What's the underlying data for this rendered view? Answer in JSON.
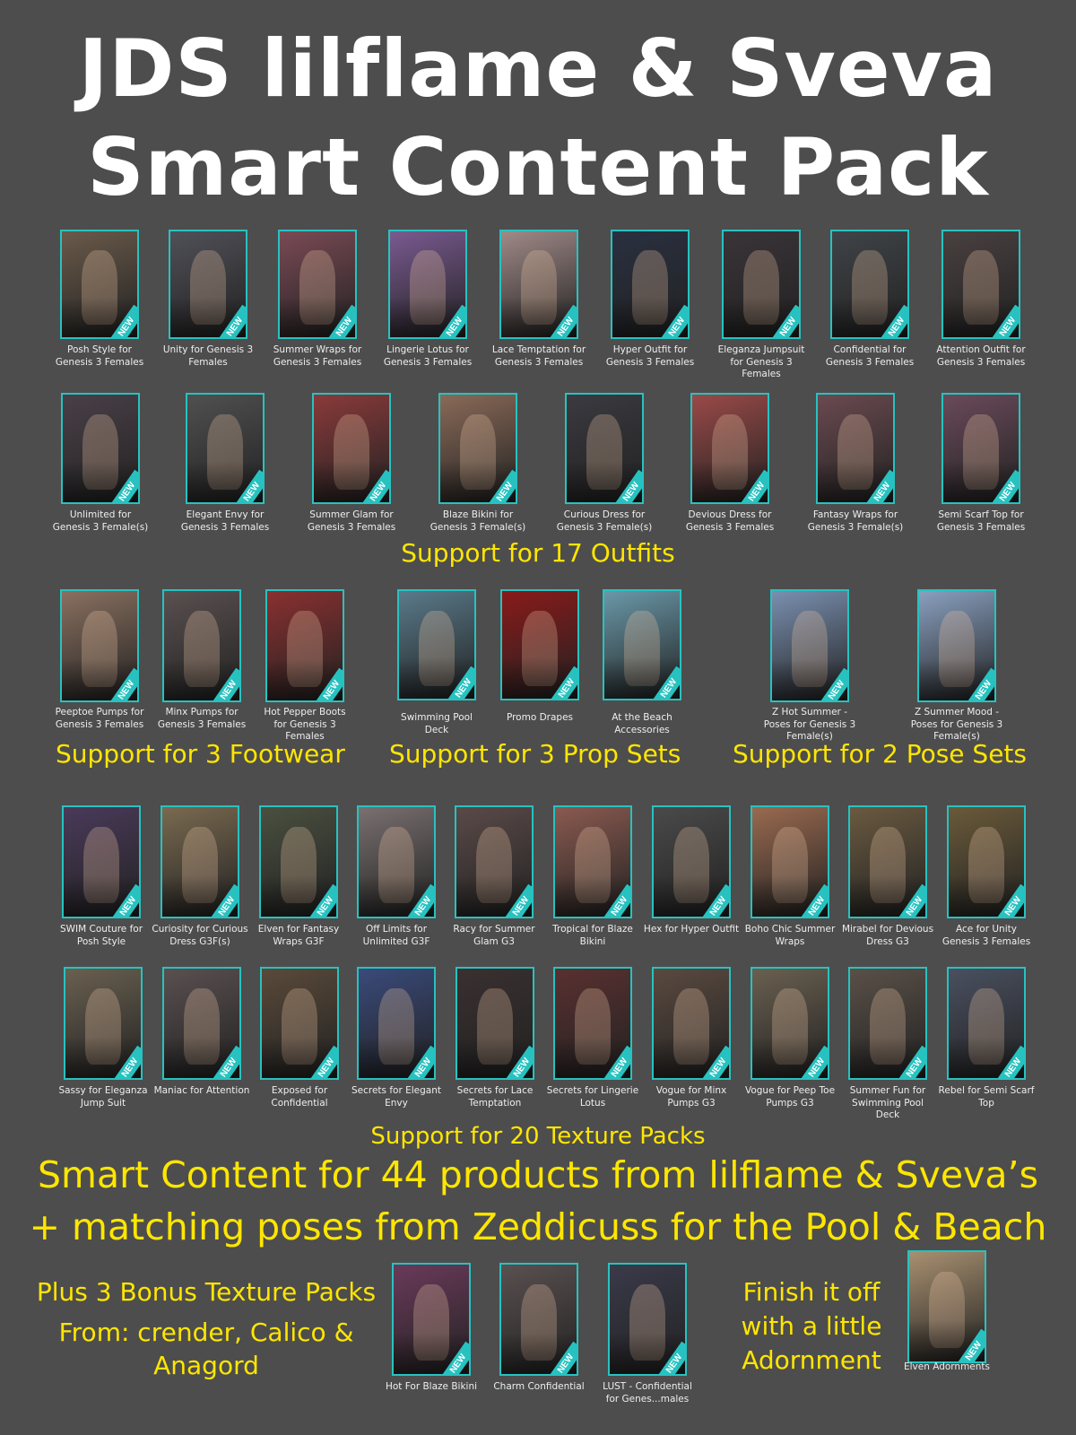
{
  "title_line1": "JDS lilflame & Sveva",
  "title_line2": "Smart Content Pack",
  "outfits_row1": [
    {
      "caption": "Posh Style for Genesis 3 Females",
      "color": "#6a5a4a"
    },
    {
      "caption": "Unity for Genesis 3 Females",
      "color": "#505058"
    },
    {
      "caption": "Summer Wraps for Genesis 3 Females",
      "color": "#7a4a55"
    },
    {
      "caption": "Lingerie Lotus for Genesis 3 Females",
      "color": "#7a5a90"
    },
    {
      "caption": "Lace Temptation for Genesis 3 Females",
      "color": "#a08a88"
    },
    {
      "caption": "Hyper Outfit for Genesis 3 Females",
      "color": "#2a3040"
    },
    {
      "caption": "Eleganza Jumpsuit for Genesis 3 Females",
      "color": "#3a3438"
    },
    {
      "caption": "Confidential for Genesis 3 Females",
      "color": "#404448"
    },
    {
      "caption": "Attention Outfit for Genesis 3 Females",
      "color": "#4a4040"
    }
  ],
  "outfits_row2": [
    {
      "caption": "Unlimited for Genesis 3 Female(s)",
      "color": "#4a4048"
    },
    {
      "caption": "Elegant Envy for Genesis 3 Females",
      "color": "#505050"
    },
    {
      "caption": "Summer Glam for Genesis 3 Females",
      "color": "#8a3a3a"
    },
    {
      "caption": "Blaze Bikini for Genesis 3 Female(s)",
      "color": "#8a6a58"
    },
    {
      "caption": "Curious Dress for Genesis 3 Female(s)",
      "color": "#3a3a40"
    },
    {
      "caption": "Devious Dress for Genesis 3 Females",
      "color": "#9a4a48"
    },
    {
      "caption": "Fantasy Wraps for Genesis 3 Female(s)",
      "color": "#6a4a50"
    },
    {
      "caption": "Semi Scarf Top for Genesis 3 Females",
      "color": "#6a4a5a"
    }
  ],
  "support_outfits": "Support for 17 Outfits",
  "footwear": [
    {
      "caption": "Peeptoe Pumps for Genesis 3 Females",
      "color": "#8a7060"
    },
    {
      "caption": "Minx Pumps for Genesis 3 Females",
      "color": "#5a5050"
    },
    {
      "caption": "Hot Pepper Boots for Genesis 3 Females",
      "color": "#8a3030"
    }
  ],
  "props": [
    {
      "caption": "Swimming Pool Deck",
      "color": "#5a7a8a"
    },
    {
      "caption": "Promo Drapes",
      "color": "#8a1a1a"
    },
    {
      "caption": "At the Beach Accessories",
      "color": "#6a98a8"
    }
  ],
  "poses": [
    {
      "caption": "Z Hot Summer - Poses for Genesis 3 Female(s)",
      "color": "#7a90b0"
    },
    {
      "caption": "Z Summer Mood - Poses for Genesis 3 Female(s)",
      "color": "#8aa0c0"
    }
  ],
  "support_footwear": "Support for 3 Footwear",
  "support_props": "Support for 3 Prop Sets",
  "support_poses": "Support for 2 Pose Sets",
  "textures_row1": [
    {
      "caption": "SWIM Couture for Posh Style",
      "color": "#4a3a5a"
    },
    {
      "caption": "Curiosity for Curious Dress G3F(s)",
      "color": "#7a6a50"
    },
    {
      "caption": "Elven for Fantasy Wraps G3F",
      "color": "#4a5040"
    },
    {
      "caption": "Off Limits for Unlimited G3F",
      "color": "#7a7070"
    },
    {
      "caption": "Racy for Summer Glam G3",
      "color": "#5a4a48"
    },
    {
      "caption": "Tropical for Blaze Bikini",
      "color": "#8a5a50"
    },
    {
      "caption": "Hex for Hyper Outfit",
      "color": "#4a4a4a"
    },
    {
      "caption": "Boho Chic Summer Wraps",
      "color": "#9a6a50"
    },
    {
      "caption": "Mirabel for Devious Dress G3",
      "color": "#6a5a40"
    },
    {
      "caption": "Ace for Unity Genesis 3 Females",
      "color": "#6a5a3a"
    }
  ],
  "textures_row2": [
    {
      "caption": "Sassy for Eleganza Jump Suit",
      "color": "#6a6050"
    },
    {
      "caption": "Maniac for Attention",
      "color": "#5a5050"
    },
    {
      "caption": "Exposed for Confidential",
      "color": "#5a4a3a"
    },
    {
      "caption": "Secrets for Elegant Envy",
      "color": "#3a4a7a"
    },
    {
      "caption": "Secrets for Lace Temptation",
      "color": "#3a3030"
    },
    {
      "caption": "Secrets for Lingerie Lotus",
      "color": "#5a3030"
    },
    {
      "caption": "Vogue for Minx Pumps G3",
      "color": "#5a4a40"
    },
    {
      "caption": "Vogue for Peep Toe Pumps G3",
      "color": "#6a6050"
    },
    {
      "caption": "Summer Fun for Swimming Pool Deck",
      "color": "#5a5048"
    },
    {
      "caption": "Rebel for Semi Scarf Top",
      "color": "#4a5060"
    }
  ],
  "support_textures": "Support for 20 Texture Packs",
  "smart_line1": "Smart Content for 44 products from lilflame & Sveva’s",
  "smart_line2": "+ matching poses from Zeddicuss for the Pool & Beach",
  "bonus_line1": "Plus 3 Bonus Texture Packs",
  "bonus_line2": "From: crender, Calico &",
  "bonus_line3": "Anagord",
  "bonus": [
    {
      "caption": "Hot For Blaze Bikini",
      "color": "#6a3a5a"
    },
    {
      "caption": "Charm Confidential",
      "color": "#5a5050"
    },
    {
      "caption": "LUST - Confidential for Genes...males",
      "color": "#3a3a4a"
    }
  ],
  "finish_line1": "Finish it off",
  "finish_line2": "with a little",
  "finish_line3": "Adornment",
  "adornment": {
    "caption": "Elven Adornments",
    "color": "#a89070"
  },
  "new_badge": "NEW",
  "accent_color": "#27c2c0",
  "yellow_color": "#ffe600"
}
